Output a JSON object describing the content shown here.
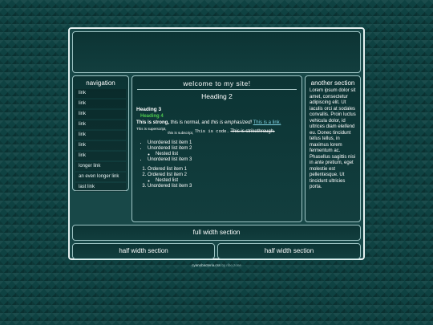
{
  "header": {
    "text": ""
  },
  "nav": {
    "title": "navigation",
    "items": [
      "link",
      "link",
      "link",
      "link",
      "link",
      "link",
      "link",
      "longer link",
      "an even longer link",
      "last link"
    ]
  },
  "main": {
    "title": "welcome to my site!",
    "h2": "Heading 2",
    "h3": "Heading 3",
    "h4": "Heading 4",
    "strong": "This is strong,",
    "normal": " this is normal, and ",
    "em": "this is emphasized!",
    "link": "This is a link.",
    "sup": "This is superscript,",
    "sub": "this is subscript,",
    "code": "This is code.",
    "strike": "This is strikethrough.",
    "ul": [
      "Unordered list item 1",
      "Unordered list item 2",
      "Nested list",
      "Unordered list item 3"
    ],
    "ol": [
      "Ordered list item 1",
      "Ordered list item 2",
      "Nested list",
      "Unordered list item 3"
    ]
  },
  "aside": {
    "title": "another section",
    "text": "Lorem ipsum dolor sit amet, consectetur adipiscing elit. Ut iaculis orci at sodales convallis. Proin luctus vehicula dolor, id ultrices diam eleifend eu. Donec tincidunt tellus tellus, in maximus lorem fermentum ac. Phasellus sagittis nisi in ante pretium, eget molestie est pellentesque. Ut tincidunt ultricies porta."
  },
  "full": "full width section",
  "half1": "half width section",
  "half2": "half width section",
  "footer": {
    "name": "cyanobacteria.css",
    "by": " by ribo.zone"
  }
}
